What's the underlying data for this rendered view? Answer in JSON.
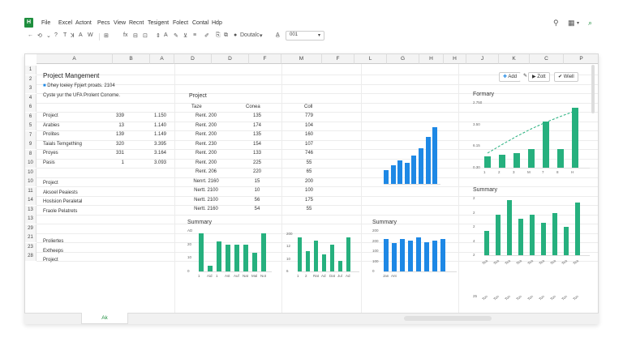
{
  "menubar": {
    "logo": "H",
    "items": [
      "File",
      "Excel",
      "Actont",
      "Pecs",
      "View",
      "Recnt",
      "Tesigent",
      "Folect",
      "Contal",
      "Hdp"
    ]
  },
  "toolbar": {
    "font_name": "Doutalc",
    "font_size": "001"
  },
  "sheet": {
    "columns": [
      "A",
      "B",
      "A",
      "D",
      "D",
      "F",
      "M",
      "F",
      "L",
      "G",
      "H",
      "H",
      "J",
      "K",
      "C",
      "P"
    ],
    "rows": [
      "1",
      "2",
      "3",
      "4",
      "6",
      "6",
      "5",
      "7",
      "9",
      "8",
      "10",
      "10",
      "10",
      "11",
      "14",
      "13",
      "13",
      "29",
      "21",
      "23",
      "28"
    ],
    "title": "Project Mangement",
    "subtitle": "Dhey loeiey Fpjert proats. 2104",
    "subtitle2": "Cyste yur the UFA Prolent Conome.",
    "table1": [
      [
        "Project",
        "339",
        "1.150"
      ],
      [
        "Arabies",
        "13",
        "1.140"
      ],
      [
        "Prolites",
        "139",
        "1.149"
      ],
      [
        "Taials Temgething",
        "320",
        "3.395"
      ],
      [
        "Proyes",
        "331",
        "3.164"
      ],
      [
        "Pasis",
        "1",
        "3.093"
      ]
    ],
    "table1b": [
      "Project",
      "Aksoel Peaiests",
      "Hoslsion Peraletal",
      "Fraole Pelatrets"
    ],
    "table1c": [
      "Proliertes",
      "Extheeps",
      "Project"
    ],
    "table2_title": "Project",
    "table2_headers": [
      "Taze",
      "Conea",
      "Coll"
    ],
    "table2": [
      [
        "Rent. 200",
        "135",
        "779"
      ],
      [
        "Rent. 200",
        "174",
        "104"
      ],
      [
        "Rent. 200",
        "135",
        "160"
      ],
      [
        "Rent. 230",
        "154",
        "107"
      ],
      [
        "Rent. 200",
        "133",
        "746"
      ],
      [
        "Rent. 200",
        "225",
        "55"
      ],
      [
        "Rent. 206",
        "220",
        "65"
      ],
      [
        "Nenrt. 2160",
        "15",
        "200"
      ],
      [
        "Nertt. 2100",
        "10",
        "100"
      ],
      [
        "Nertt. 2100",
        "56",
        "175"
      ],
      [
        "Nertt. 2160",
        "54",
        "55"
      ]
    ],
    "buttons": {
      "add": "Add",
      "edit": "Zott",
      "apply": "Wiell"
    },
    "sheet_tab": "Ak"
  },
  "chart_data": [
    {
      "type": "bar",
      "title": "",
      "values": [
        15,
        20,
        25,
        22,
        30,
        38,
        50,
        60
      ],
      "color": "#1e88e5"
    },
    {
      "type": "bar",
      "title": "Formary",
      "categories": [
        "1",
        "2",
        "3",
        "M",
        "7",
        "8",
        "H"
      ],
      "values": [
        12,
        14,
        16,
        20,
        50,
        20,
        65
      ],
      "color": "#26b07e",
      "yticks": [
        "2.750",
        "3.50",
        "6.15",
        "0.30"
      ],
      "trend": true
    },
    {
      "type": "bar",
      "title": "Summary",
      "values": [
        30,
        50,
        68,
        45,
        50,
        40,
        52,
        35,
        65
      ],
      "color": "#26b07e",
      "yticks": [
        "2",
        "2",
        "2",
        "4",
        "2"
      ],
      "xticks": [
        "Tea",
        "Tea",
        "Tea",
        "Tea",
        "Tea",
        "Tea",
        "Tea",
        "Tea",
        "Tea"
      ],
      "xticks_lower": [
        "Ton",
        "Ton",
        "Ton",
        "Ton",
        "Ton",
        "Ton",
        "Ton",
        "Ton",
        "Ton"
      ],
      "xmark": "25"
    },
    {
      "type": "bar",
      "title": "Summary",
      "categories": [
        "1",
        "Aid",
        "1",
        "Ast",
        "Auf",
        "Nat",
        "Mal",
        "Not"
      ],
      "values": [
        70,
        10,
        55,
        50,
        50,
        50,
        35,
        70
      ],
      "color": "#26b07e",
      "yticks": [
        "AD",
        "20",
        "10",
        "0"
      ]
    },
    {
      "type": "bar",
      "title": "",
      "categories": [
        "1",
        "2",
        "Rat",
        "Ad",
        "Dat",
        "Jul",
        "Ad"
      ],
      "values": [
        50,
        30,
        45,
        25,
        40,
        15,
        50
      ],
      "color": "#26b07e",
      "yticks": [
        "200",
        "12",
        "10",
        "6"
      ]
    },
    {
      "type": "bar",
      "title": "Summary",
      "categories": [
        "Jan",
        "Ant"
      ],
      "values": [
        40,
        35,
        40,
        38,
        42,
        36,
        38,
        40
      ],
      "color": "#1e88e5",
      "yticks": [
        "200",
        "200",
        "100",
        "100",
        "0"
      ]
    }
  ]
}
